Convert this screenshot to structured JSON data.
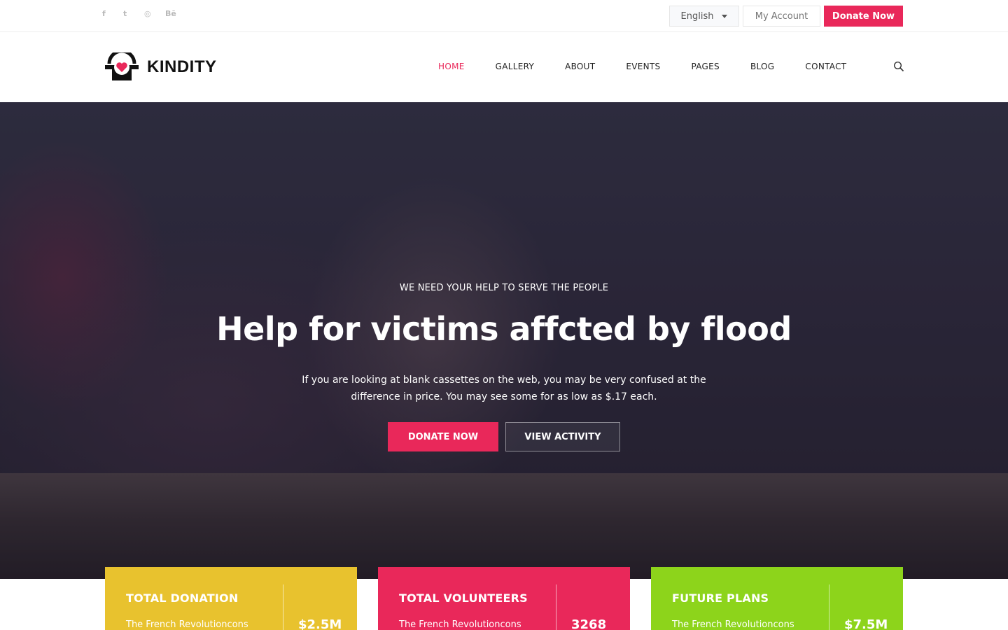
{
  "topbar": {
    "social": [
      {
        "icon": "facebook-icon",
        "glyph": "f"
      },
      {
        "icon": "twitter-icon",
        "glyph": "t"
      },
      {
        "icon": "dribbble-icon",
        "glyph": "◎"
      },
      {
        "icon": "behance-icon",
        "glyph": "Bē"
      }
    ],
    "language": "English",
    "account_label": "My Account",
    "donate_label": "Donate Now"
  },
  "header": {
    "logo_text": "KINDITY",
    "nav": [
      "HOME",
      "GALLERY",
      "ABOUT",
      "EVENTS",
      "PAGES",
      "BLOG",
      "CONTACT"
    ],
    "active_nav": "HOME"
  },
  "hero": {
    "kicker": "WE NEED YOUR HELP TO SERVE THE PEOPLE",
    "headline": "Help for victims affcted by flood",
    "description": "If you are looking at blank cassettes on the web, you may be very confused at the difference in price. You may see some for as low as $.17 each.",
    "donate_button": "DONATE NOW",
    "view_button": "VIEW ACTIVITY"
  },
  "stats": [
    {
      "title": "TOTAL DONATION",
      "subtitle": "The French Revolutioncons",
      "value": "$2.5M",
      "color": "#e8c22e"
    },
    {
      "title": "TOTAL VOLUNTEERS",
      "subtitle": "The French Revolutioncons",
      "value": "3268",
      "color": "#e9285a"
    },
    {
      "title": "FUTURE PLANS",
      "subtitle": "The French Revolutioncons",
      "value": "$7.5M",
      "color": "#8dd41b"
    }
  ],
  "colors": {
    "accent": "#e9285a"
  }
}
